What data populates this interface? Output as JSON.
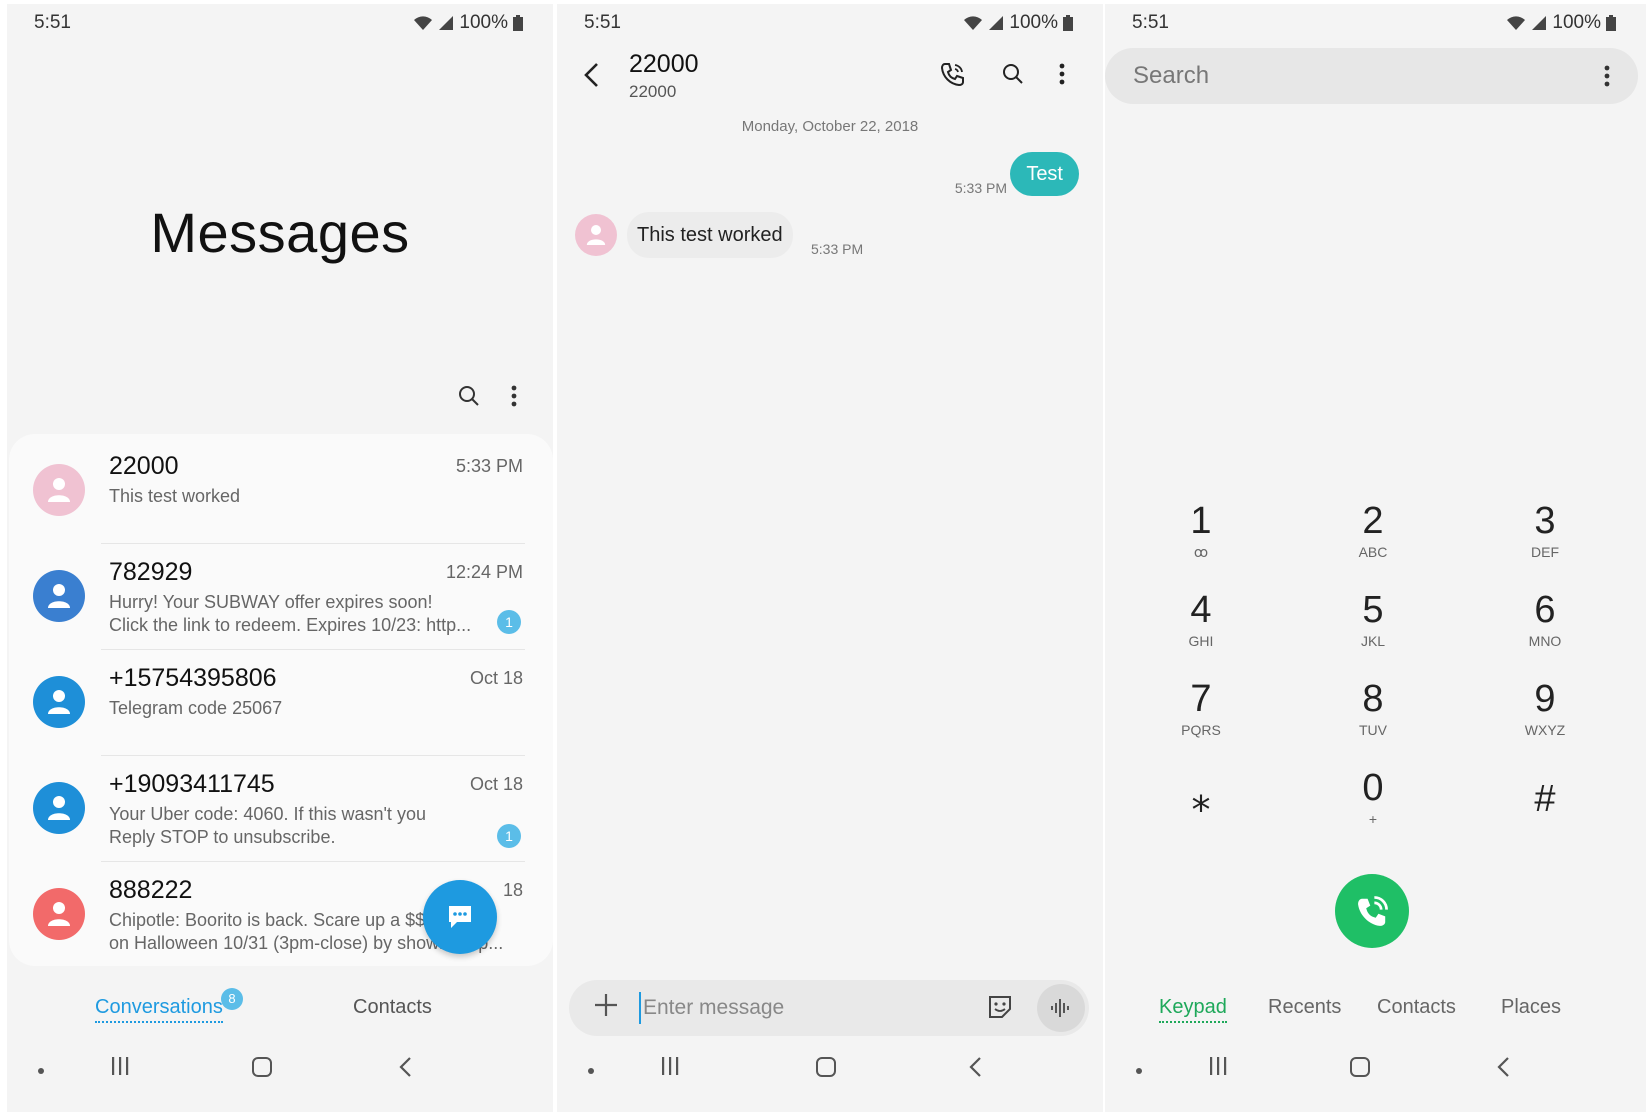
{
  "colors": {
    "accent_blue": "#1e9ae0",
    "teal": "#2cb8b8",
    "green": "#1fbf66",
    "badge": "#5bbde8"
  },
  "status": {
    "time": "5:51",
    "battery": "100%"
  },
  "messages_list": {
    "title": "Messages",
    "conversations": [
      {
        "name": "22000",
        "time": "5:33 PM",
        "line1": "This test worked",
        "line2": "",
        "badge": "",
        "avatar_color": "#f0c2d2"
      },
      {
        "name": "782929",
        "time": "12:24 PM",
        "line1": "Hurry! Your SUBWAY offer expires soon!",
        "line2": "Click the link to redeem. Expires 10/23: http...",
        "badge": "1",
        "avatar_color": "#3a7fd0"
      },
      {
        "name": "+15754395806",
        "time": "Oct 18",
        "line1": "Telegram code 25067",
        "line2": "",
        "badge": "",
        "avatar_color": "#1e8fd8"
      },
      {
        "name": "+19093411745",
        "time": "Oct 18",
        "line1": "Your Uber code: 4060. If this wasn't you",
        "line2": "Reply STOP to unsubscribe.",
        "badge": "1",
        "avatar_color": "#1e8fd8"
      },
      {
        "name": "888222",
        "time": "18",
        "line1": "Chipotle: Boorito is back. Scare up a $$4",
        "line2": "on Halloween 10/31 (3pm-close) by showing up...",
        "badge": "",
        "avatar_color": "#f26a6a"
      }
    ],
    "tabs": {
      "conversations": "Conversations",
      "conversations_badge": "8",
      "contacts": "Contacts"
    }
  },
  "thread": {
    "title": "22000",
    "subtitle": "22000",
    "date": "Monday, October 22, 2018",
    "outgoing": {
      "text": "Test",
      "time": "5:33 PM"
    },
    "incoming": {
      "text": "This test worked",
      "time": "5:33 PM"
    },
    "composer_placeholder": "Enter message"
  },
  "dialer": {
    "search_placeholder": "Search",
    "keys": [
      {
        "digit": "1",
        "letters": "ꝏ"
      },
      {
        "digit": "2",
        "letters": "ABC"
      },
      {
        "digit": "3",
        "letters": "DEF"
      },
      {
        "digit": "4",
        "letters": "GHI"
      },
      {
        "digit": "5",
        "letters": "JKL"
      },
      {
        "digit": "6",
        "letters": "MNO"
      },
      {
        "digit": "7",
        "letters": "PQRS"
      },
      {
        "digit": "8",
        "letters": "TUV"
      },
      {
        "digit": "9",
        "letters": "WXYZ"
      },
      {
        "digit": "⁎",
        "letters": ""
      },
      {
        "digit": "0",
        "letters": "+"
      },
      {
        "digit": "#",
        "letters": ""
      }
    ],
    "tabs": [
      "Keypad",
      "Recents",
      "Contacts",
      "Places"
    ]
  }
}
